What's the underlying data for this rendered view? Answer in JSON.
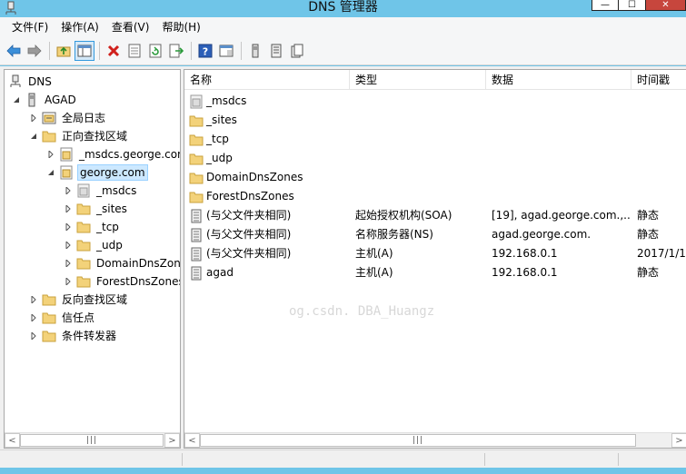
{
  "window": {
    "title": "DNS 管理器",
    "minimize_glyph": "—",
    "maximize_glyph": "☐",
    "close_glyph": "✕"
  },
  "menu": [
    "文件(F)",
    "操作(A)",
    "查看(V)",
    "帮助(H)"
  ],
  "toolbar": {
    "buttons": [
      "back-icon",
      "forward-icon",
      "up-folder-icon",
      "show-tree-icon",
      "delete-icon",
      "properties-icon",
      "refresh-icon",
      "export-list-icon",
      "help-icon",
      "console-icon",
      "server-icon",
      "list-icon",
      "copy-icon"
    ]
  },
  "tree": {
    "root": "DNS",
    "server": "AGAD",
    "global_logs": "全局日志",
    "forward_zones": "正向查找区域",
    "msdcs_zone": "_msdcs.george.com",
    "george_zone": "george.com",
    "george_children": [
      "_msdcs",
      "_sites",
      "_tcp",
      "_udp",
      "DomainDnsZones",
      "ForestDnsZones"
    ],
    "reverse_zones": "反向查找区域",
    "trust_points": "信任点",
    "conditional_forwarders": "条件转发器"
  },
  "list": {
    "columns": [
      "名称",
      "类型",
      "数据",
      "时间戳"
    ],
    "rows": [
      {
        "name": "_msdcs",
        "type": "",
        "data": "",
        "timestamp": "",
        "icon": "zone-folder-icon"
      },
      {
        "name": "_sites",
        "type": "",
        "data": "",
        "timestamp": "",
        "icon": "folder-icon"
      },
      {
        "name": "_tcp",
        "type": "",
        "data": "",
        "timestamp": "",
        "icon": "folder-icon"
      },
      {
        "name": "_udp",
        "type": "",
        "data": "",
        "timestamp": "",
        "icon": "folder-icon"
      },
      {
        "name": "DomainDnsZones",
        "type": "",
        "data": "",
        "timestamp": "",
        "icon": "folder-icon"
      },
      {
        "name": "ForestDnsZones",
        "type": "",
        "data": "",
        "timestamp": "",
        "icon": "folder-icon"
      },
      {
        "name": "(与父文件夹相同)",
        "type": "起始授权机构(SOA)",
        "data": "[19], agad.george.com.,...",
        "timestamp": "静态",
        "icon": "record-icon"
      },
      {
        "name": "(与父文件夹相同)",
        "type": "名称服务器(NS)",
        "data": "agad.george.com.",
        "timestamp": "静态",
        "icon": "record-icon"
      },
      {
        "name": "(与父文件夹相同)",
        "type": "主机(A)",
        "data": "192.168.0.1",
        "timestamp": "2017/1/1",
        "icon": "record-icon"
      },
      {
        "name": "agad",
        "type": "主机(A)",
        "data": "192.168.0.1",
        "timestamp": "静态",
        "icon": "record-icon"
      }
    ]
  },
  "watermark": "og.csdn.   DBA_Huangz",
  "scroll": {
    "thumb_glyph": "|||",
    "left_glyph": "<",
    "right_glyph": ">"
  }
}
